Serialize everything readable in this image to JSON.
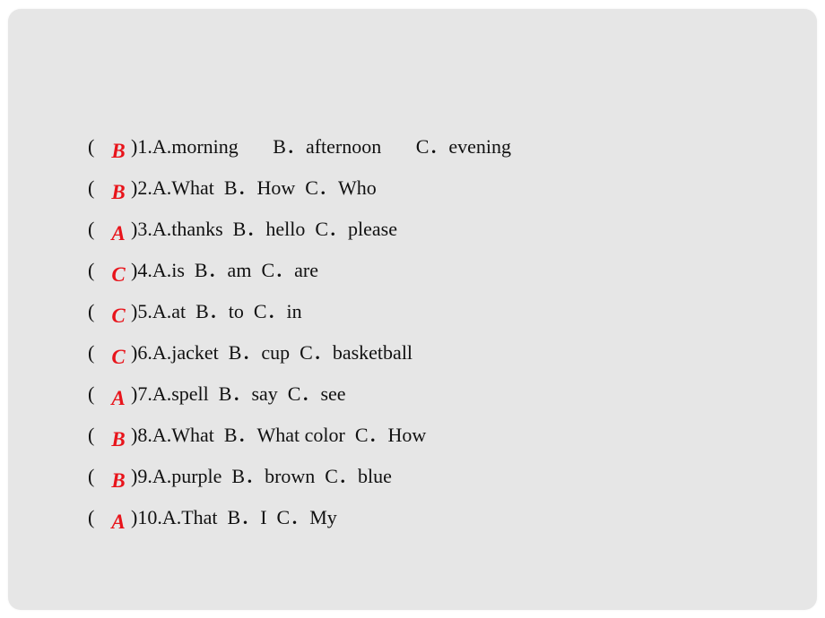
{
  "colors": {
    "background": "#e6e6e6",
    "text": "#111111",
    "answer": "#e8141b"
  },
  "questions": [
    {
      "answer": "B",
      "text": ")1.A.morning       B．afternoon       C．evening"
    },
    {
      "answer": "B",
      "text": ")2.A.What  B．How  C．Who"
    },
    {
      "answer": "A",
      "text": ")3.A.thanks  B．hello  C．please"
    },
    {
      "answer": "C",
      "text": ")4.A.is  B．am  C．are"
    },
    {
      "answer": "C",
      "text": ")5.A.at  B．to  C．in"
    },
    {
      "answer": "C",
      "text": ")6.A.jacket  B．cup  C．basketball"
    },
    {
      "answer": "A",
      "text": ")7.A.spell  B．say  C．see"
    },
    {
      "answer": "B",
      "text": ")8.A.What  B．What color  C．How"
    },
    {
      "answer": "B",
      "text": ")9.A.purple  B．brown  C．blue"
    },
    {
      "answer": "A",
      "text": ")10.A.That  B．I  C．My"
    }
  ],
  "paren_open": "("
}
